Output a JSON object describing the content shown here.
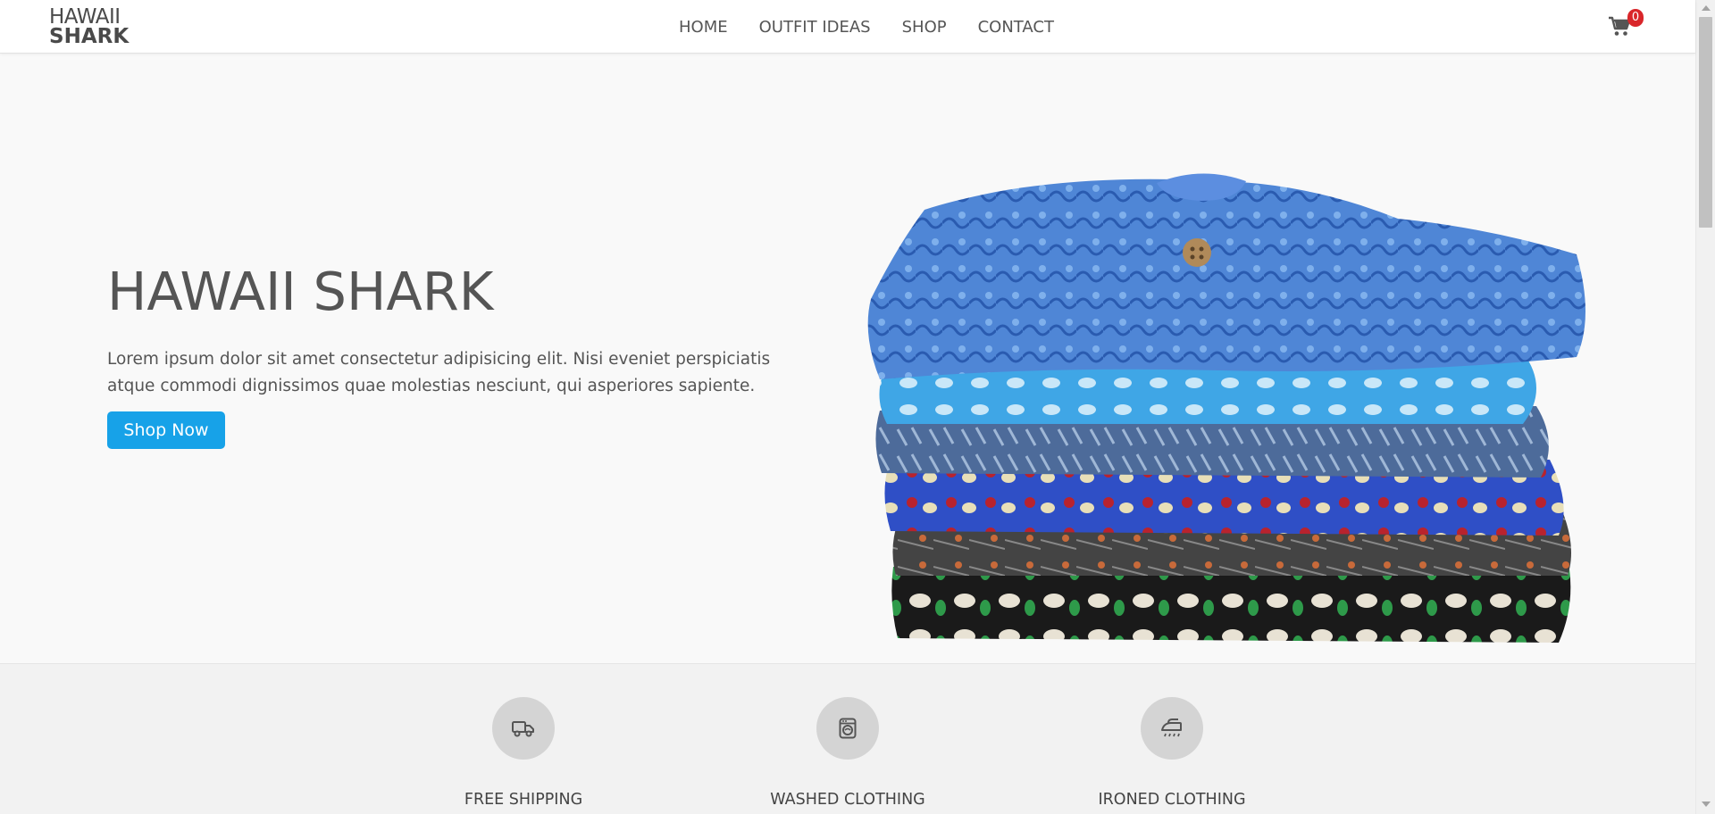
{
  "brand": {
    "line1": "HAWAII",
    "line2": "SHARK"
  },
  "nav": {
    "items": [
      {
        "label": "HOME"
      },
      {
        "label": "OUTFIT IDEAS"
      },
      {
        "label": "SHOP"
      },
      {
        "label": "CONTACT"
      }
    ]
  },
  "cart": {
    "count": "0",
    "icon": "shopping-cart-icon"
  },
  "hero": {
    "title": "HAWAII SHARK",
    "text": "Lorem ipsum dolor sit amet consectetur adipisicing elit. Nisi eveniet perspiciatis atque commodi dignissimos quae molestias nesciunt, qui asperiores sapiente.",
    "button_label": "Shop Now",
    "image": "stack-of-hawaiian-shirts"
  },
  "features": [
    {
      "label": "FREE SHIPPING",
      "icon": "truck-icon"
    },
    {
      "label": "WASHED CLOTHING",
      "icon": "washing-machine-icon"
    },
    {
      "label": "IRONED CLOTHING",
      "icon": "iron-icon"
    }
  ],
  "colors": {
    "accent": "#17a2e8",
    "badge": "#d9262a",
    "text": "#555555"
  }
}
